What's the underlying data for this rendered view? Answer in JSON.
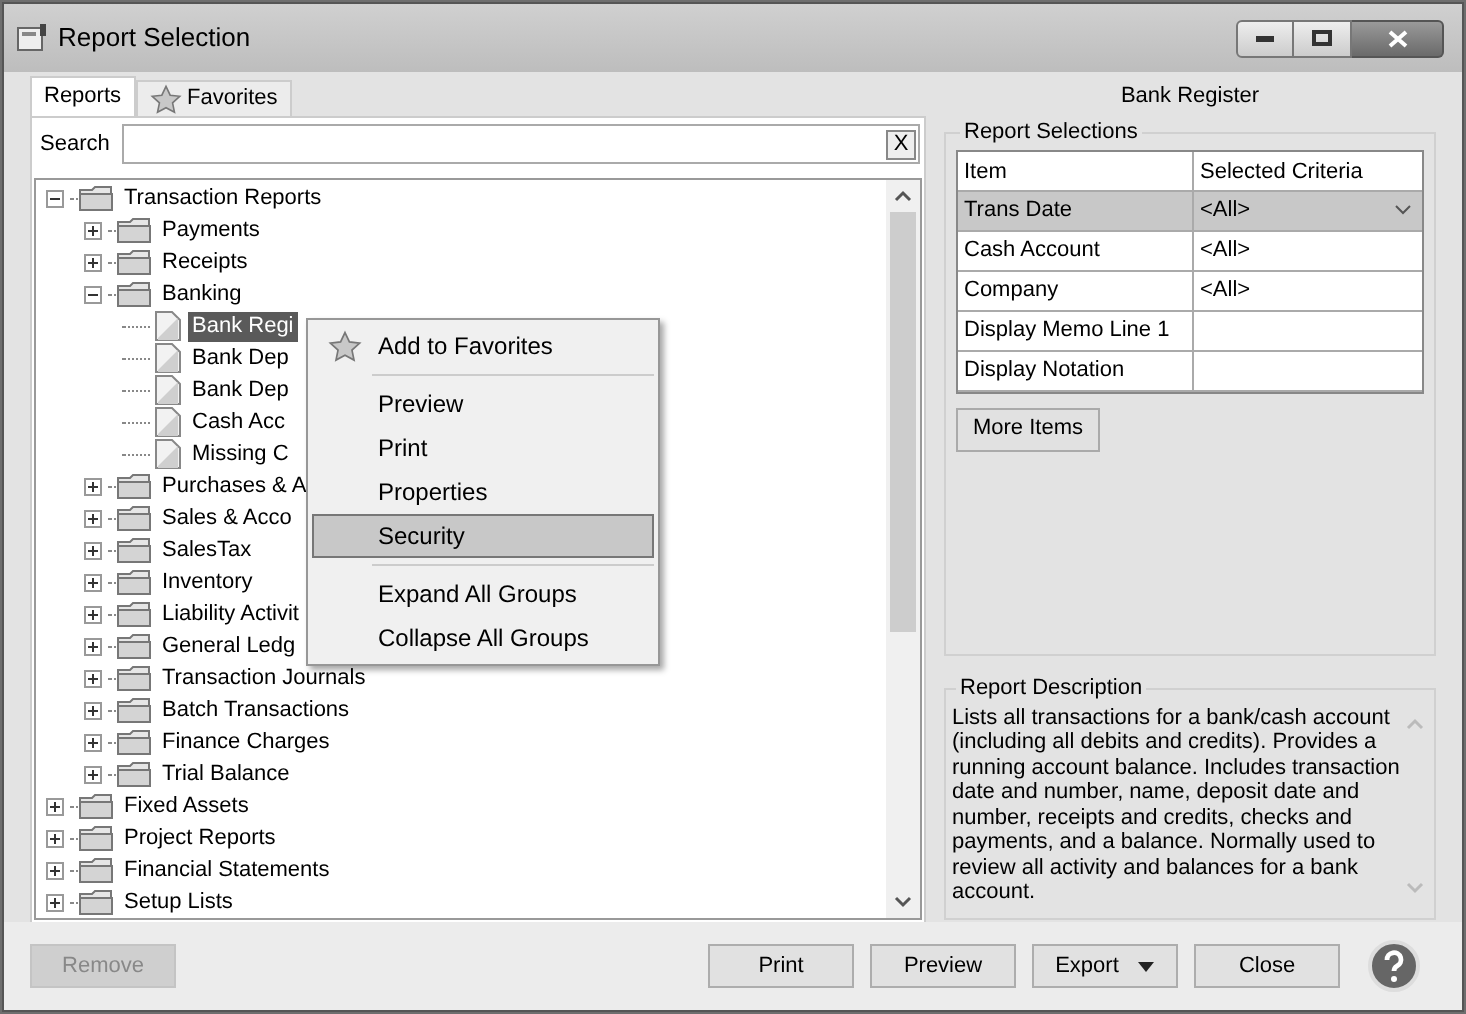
{
  "window": {
    "title": "Report Selection"
  },
  "tabs": [
    {
      "label": "Reports",
      "selected": true
    },
    {
      "label": "Favorites",
      "selected": false
    }
  ],
  "search": {
    "label": "Search",
    "clear": "X"
  },
  "tree": [
    {
      "label": "Transaction Reports",
      "expanded": true,
      "selected": false,
      "children": [
        {
          "label": "Payments",
          "expanded": false,
          "selected": false
        },
        {
          "label": "Receipts",
          "expanded": false,
          "selected": false
        },
        {
          "label": "Banking",
          "expanded": true,
          "selected": false,
          "children": [
            {
              "label": "Bank Regi",
              "kind": "report",
              "selected": true
            },
            {
              "label": "Bank Dep",
              "kind": "report",
              "selected": false
            },
            {
              "label": "Bank Dep",
              "kind": "report",
              "selected": false
            },
            {
              "label": "Cash Acc",
              "kind": "report",
              "selected": false
            },
            {
              "label": "Missing C",
              "kind": "report",
              "selected": false
            }
          ]
        },
        {
          "label": "Purchases & A",
          "expanded": false,
          "selected": false
        },
        {
          "label": "Sales & Acco",
          "expanded": false,
          "selected": false
        },
        {
          "label": "SalesTax",
          "expanded": false,
          "selected": false
        },
        {
          "label": "Inventory",
          "expanded": false,
          "selected": false
        },
        {
          "label": "Liability Activit",
          "expanded": false,
          "selected": false
        },
        {
          "label": "General Ledg",
          "expanded": false,
          "selected": false
        },
        {
          "label": "Transaction Journals",
          "expanded": false,
          "selected": false
        },
        {
          "label": "Batch Transactions",
          "expanded": false,
          "selected": false
        },
        {
          "label": "Finance Charges",
          "expanded": false,
          "selected": false
        },
        {
          "label": "Trial Balance",
          "expanded": false,
          "selected": false
        }
      ]
    },
    {
      "label": "Fixed Assets",
      "expanded": false,
      "selected": false
    },
    {
      "label": "Project Reports",
      "expanded": false,
      "selected": false
    },
    {
      "label": "Financial Statements",
      "expanded": false,
      "selected": false
    },
    {
      "label": "Setup Lists",
      "expanded": false,
      "selected": false
    }
  ],
  "context_menu": {
    "groups": [
      [
        {
          "label": "Add to Favorites",
          "selected": false
        }
      ],
      [
        {
          "label": "Preview",
          "selected": false
        },
        {
          "label": "Print",
          "selected": false
        },
        {
          "label": "Properties",
          "selected": false
        },
        {
          "label": "Security",
          "selected": true
        }
      ],
      [
        {
          "label": "Expand All Groups",
          "selected": false
        },
        {
          "label": "Collapse All Groups",
          "selected": false
        }
      ]
    ]
  },
  "report_title": "Bank Register",
  "report_selections": {
    "title": "Report Selections",
    "columns": [
      "Item",
      "Selected Criteria"
    ],
    "rows": [
      {
        "item": "Trans Date",
        "criteria": "<All>",
        "selected": true
      },
      {
        "item": "Cash Account",
        "criteria": "<All>",
        "selected": false
      },
      {
        "item": "Company",
        "criteria": "<All>",
        "selected": false
      },
      {
        "item": "Display Memo Line 1",
        "selected": false
      },
      {
        "item": "Display Notation",
        "selected": false
      }
    ],
    "more_button": "More Items"
  },
  "report_description": {
    "title": "Report Description",
    "text": "Lists all transactions for a bank/cash account (including all debits and credits). Provides a running account balance.  Includes transaction date and number, name, deposit date and number, receipts and credits, checks and payments, and a balance. Normally used to review all activity and balances for a bank account."
  },
  "buttons": [
    {
      "label": "Remove",
      "disabled": true,
      "kind": "plain"
    },
    {
      "label": "Print",
      "disabled": false,
      "kind": "plain"
    },
    {
      "label": "Preview",
      "disabled": false,
      "kind": "plain"
    },
    {
      "label": "Export",
      "disabled": false,
      "kind": "dropdown"
    },
    {
      "label": "Close",
      "disabled": false,
      "kind": "plain"
    }
  ]
}
